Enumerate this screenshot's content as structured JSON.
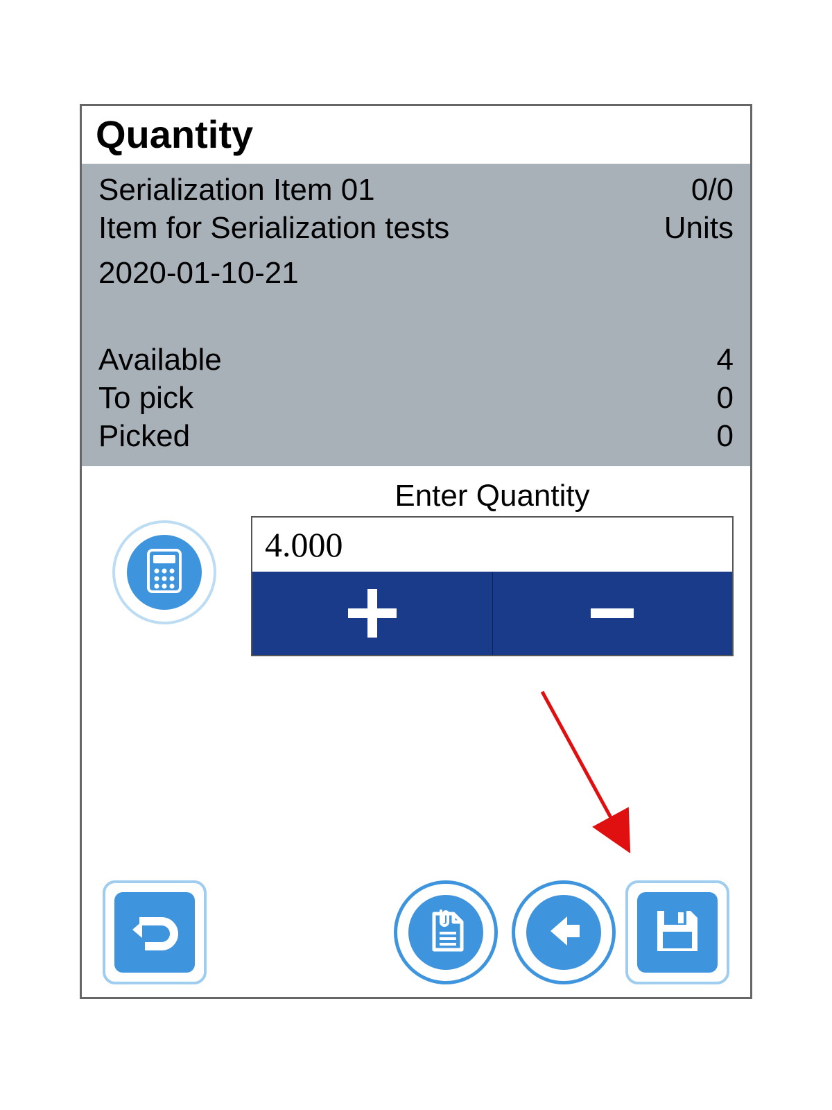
{
  "title": "Quantity",
  "item": {
    "name": "Serialization Item 01",
    "description": "Item for Serialization tests",
    "progress": "0/0",
    "uom": "Units",
    "date": "2020-01-10-21"
  },
  "stats": {
    "available_label": "Available",
    "available_value": "4",
    "to_pick_label": "To pick",
    "to_pick_value": "0",
    "picked_label": "Picked",
    "picked_value": "0"
  },
  "entry": {
    "label": "Enter Quantity",
    "value": "4.000"
  }
}
